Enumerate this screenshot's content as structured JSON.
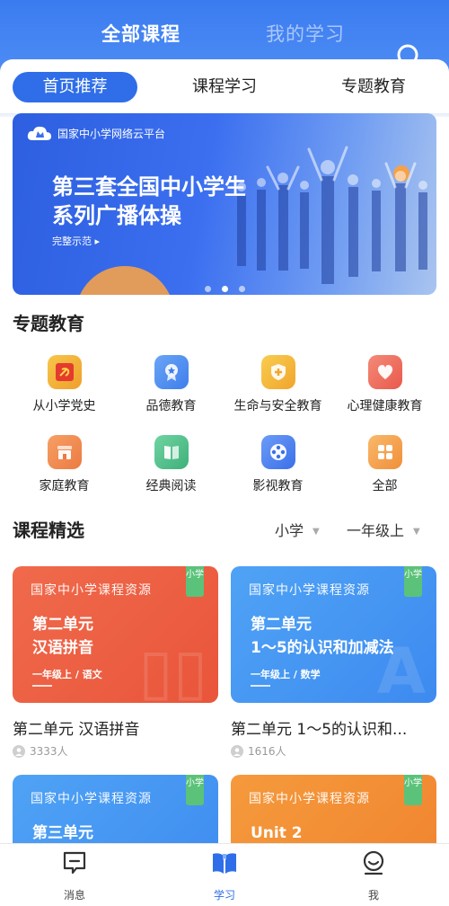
{
  "header": {
    "tabs": [
      {
        "label": "全部课程",
        "active": true
      },
      {
        "label": "我的学习",
        "active": false
      }
    ],
    "search_icon": "search-icon"
  },
  "sub_tabs": [
    "首页推荐",
    "课程学习",
    "专题教育"
  ],
  "banner": {
    "logo_text": "国家中小学网络云平台",
    "title_line1": "第三套全国中小学生",
    "title_line2": "系列广播体操",
    "link": "完整示范 ▸",
    "slide_count": 3,
    "active_slide": 2
  },
  "topics_section": {
    "title": "专题教育",
    "items": [
      {
        "label": "从小学党史",
        "icon": "party-emblem-icon",
        "color": "#f2b53a"
      },
      {
        "label": "品德教育",
        "icon": "medal-icon",
        "color": "#4f8ff0"
      },
      {
        "label": "生命与安全教育",
        "icon": "shield-icon",
        "color": "#f5b338"
      },
      {
        "label": "心理健康教育",
        "icon": "heart-icon",
        "color": "#ef6b5b"
      },
      {
        "label": "家庭教育",
        "icon": "house-icon",
        "color": "#f08a4e"
      },
      {
        "label": "经典阅读",
        "icon": "book-icon",
        "color": "#4cc08a"
      },
      {
        "label": "影视教育",
        "icon": "film-reel-icon",
        "color": "#4a7ff2"
      },
      {
        "label": "全部",
        "icon": "grid-icon",
        "color": "#f5a24a"
      }
    ]
  },
  "courses_section": {
    "title": "课程精选",
    "filters": [
      {
        "label": "小学"
      },
      {
        "label": "一年级上"
      }
    ],
    "cards": [
      {
        "header": "国家中小学课程资源",
        "badge": "小学",
        "title_line1": "第二单元",
        "title_line2": "汉语拼音",
        "meta": "一年级上 / 语文",
        "name": "第二单元 汉语拼音",
        "count": "3333人",
        "theme": "red"
      },
      {
        "header": "国家中小学课程资源",
        "badge": "小学",
        "title_line1": "第二单元",
        "title_line2": "1～5的认识和加减法",
        "meta": "一年级上 / 数学",
        "name": "第二单元 1～5的认识和...",
        "count": "1616人",
        "theme": "blue"
      },
      {
        "header": "国家中小学课程资源",
        "badge": "小学",
        "title_line1": "第三单元",
        "title_line2": "",
        "theme": "blue"
      },
      {
        "header": "国家中小学课程资源",
        "badge": "小学",
        "title_line1": "Unit 2",
        "title_line2": "",
        "theme": "orange"
      }
    ]
  },
  "bottom_nav": [
    {
      "label": "消息",
      "icon": "message-icon",
      "active": false
    },
    {
      "label": "学习",
      "icon": "open-book-icon",
      "active": true
    },
    {
      "label": "我",
      "icon": "profile-icon",
      "active": false
    }
  ],
  "colors": {
    "primary": "#2f6ee8",
    "badge_green": "#5bc27a"
  }
}
